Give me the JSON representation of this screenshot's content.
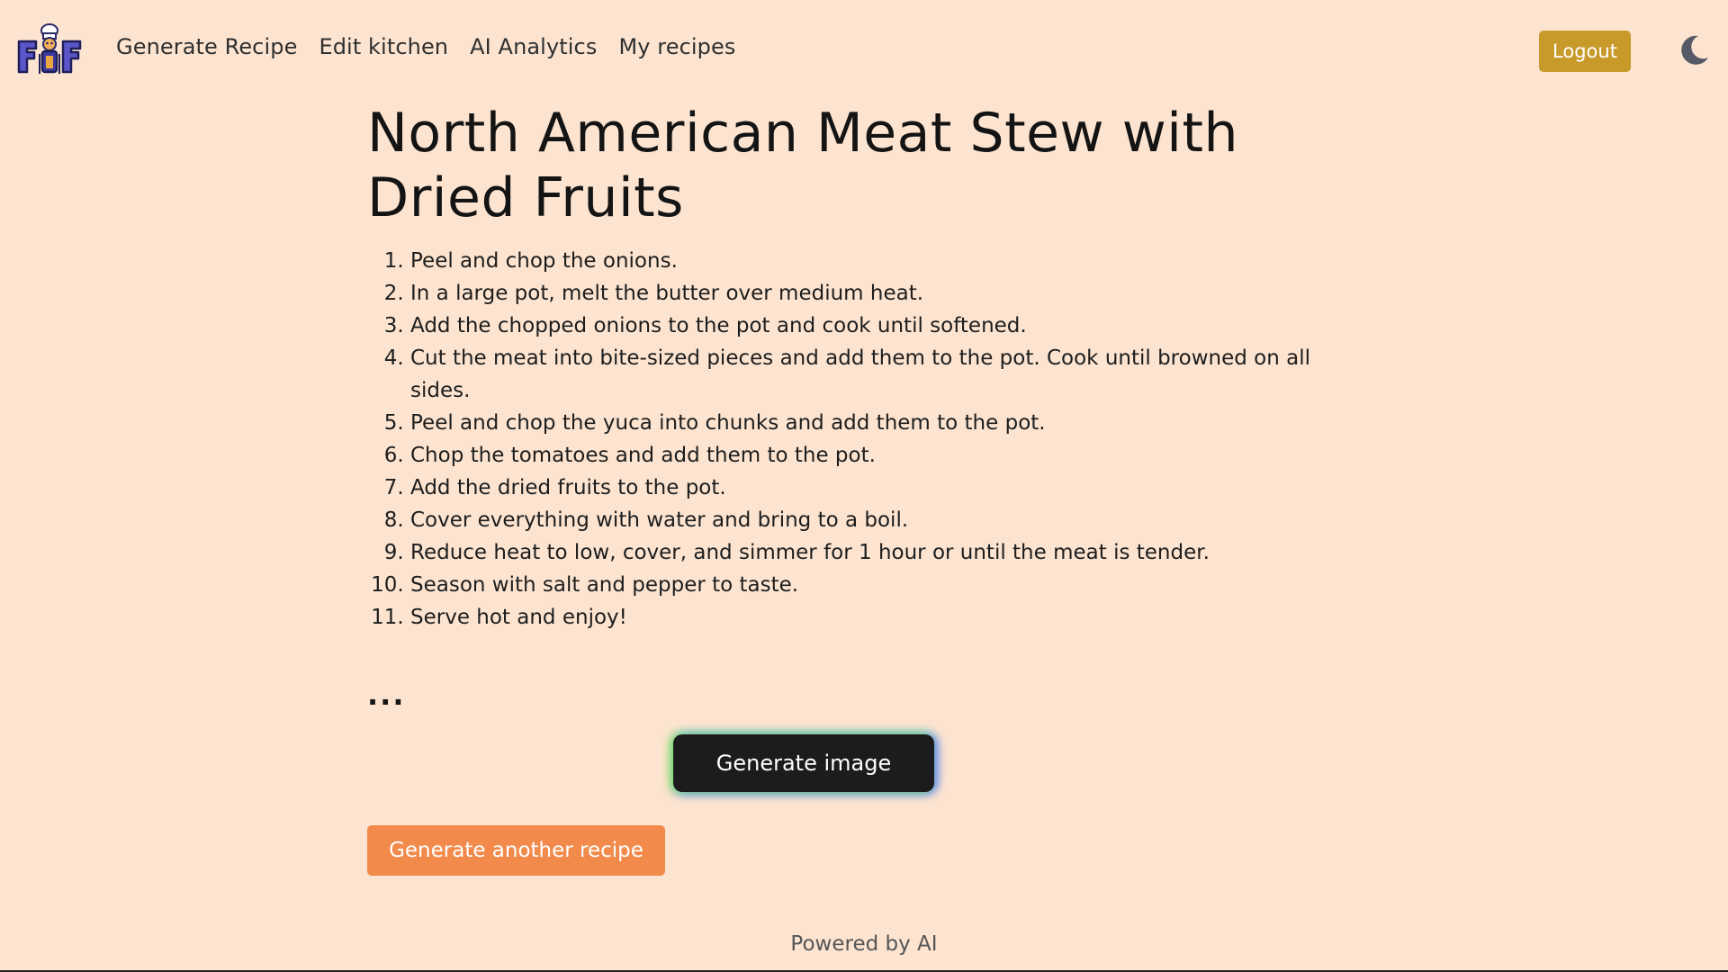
{
  "app": {
    "logo_text": "FiF"
  },
  "nav": {
    "links": [
      {
        "label": "Generate Recipe"
      },
      {
        "label": "Edit kitchen"
      },
      {
        "label": "AI Analytics"
      },
      {
        "label": "My recipes"
      }
    ],
    "logout_label": "Logout",
    "theme_icon": "moon-icon"
  },
  "recipe": {
    "title": "North American Meat Stew with Dried Fruits",
    "steps": [
      "Peel and chop the onions.",
      "In a large pot, melt the butter over medium heat.",
      "Add the chopped onions to the pot and cook until softened.",
      "Cut the meat into bite-sized pieces and add them to the pot. Cook until browned on all sides.",
      "Peel and chop the yuca into chunks and add them to the pot.",
      "Chop the tomatoes and add them to the pot.",
      "Add the dried fruits to the pot.",
      "Cover everything with water and bring to a boil.",
      "Reduce heat to low, cover, and simmer for 1 hour or until the meat is tender.",
      "Season with salt and pepper to taste.",
      "Serve hot and enjoy!"
    ],
    "ellipsis": "..."
  },
  "actions": {
    "generate_image_label": "Generate image",
    "generate_another_label": "Generate another recipe"
  },
  "footer": {
    "text": "Powered by AI"
  },
  "colors": {
    "background": "#fde4d0",
    "logout_button": "#c89a2a",
    "generate_image_button": "#1c1c1c",
    "generate_another_button": "#f28a4b"
  }
}
